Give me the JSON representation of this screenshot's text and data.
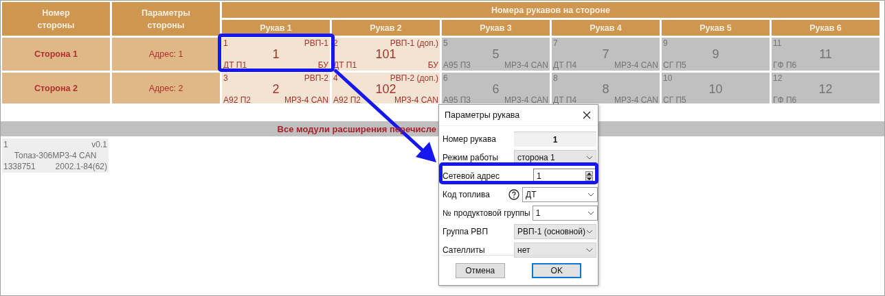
{
  "table": {
    "columns": [
      {
        "label": "Номер стороны"
      },
      {
        "label": "Параметры стороны"
      }
    ],
    "group_header": "Номера рукавов на стороне",
    "hose_columns": [
      "Рукав 1",
      "Рукав 2",
      "Рукав 3",
      "Рукав 4",
      "Рукав 5",
      "Рукав 6"
    ],
    "sides": [
      {
        "name": "Сторона 1",
        "params": "Адрес: 1",
        "hoses": [
          {
            "index": "1",
            "group": "РВП-1",
            "number": "1",
            "fuel": "ДТ П1",
            "module": "БУ",
            "enabled": true
          },
          {
            "index": "2",
            "group": "РВП-1 (доп.)",
            "number": "101",
            "fuel": "ДТ П1",
            "module": "БУ",
            "enabled": true
          },
          {
            "index": "5",
            "number": "5",
            "fuel": "А95 П3",
            "module": "МР3-4 CAN",
            "enabled": false
          },
          {
            "index": "7",
            "number": "7",
            "fuel": "ДТ П4",
            "module": "МР3-4 CAN",
            "enabled": false
          },
          {
            "index": "9",
            "number": "9",
            "fuel": "СГ П5",
            "enabled": false
          },
          {
            "index": "11",
            "number": "11",
            "fuel": "ГФ П6",
            "enabled": false
          }
        ]
      },
      {
        "name": "Сторона 2",
        "params": "Адрес: 2",
        "hoses": [
          {
            "index": "3",
            "group": "РВП-2",
            "number": "2",
            "fuel": "А92 П2",
            "module": "МР3-4 CAN",
            "enabled": true
          },
          {
            "index": "4",
            "group": "РВП-2 (доп.)",
            "number": "102",
            "fuel": "А92 П2",
            "module": "МР3-4 CAN",
            "enabled": true
          },
          {
            "index": "6",
            "number": "6",
            "fuel": "А95 П3",
            "module": "МР3-4 CAN",
            "enabled": false
          },
          {
            "index": "8",
            "number": "8",
            "fuel": "ДТ П4",
            "module": "МР3-4 CAN",
            "enabled": false
          },
          {
            "index": "10",
            "number": "10",
            "fuel": "СГ П5",
            "enabled": false
          },
          {
            "index": "12",
            "number": "12",
            "fuel": "ГФ П6",
            "enabled": false
          }
        ]
      }
    ]
  },
  "modules_bar": "Все модули расширения перечисле",
  "modules": [
    {
      "index": "1",
      "version": "v0.1",
      "name": "Топаз-306МР3-4 CAN",
      "serial": "1338751",
      "firmware": "2002.1-84(62)"
    }
  ],
  "dialog": {
    "title": "Параметры рукава",
    "fields": [
      {
        "label": "Номер рукава",
        "kind": "readonly",
        "value": "1"
      },
      {
        "label": "Режим работы",
        "kind": "list",
        "value": "сторона 1"
      },
      {
        "label": "Сетевой адрес",
        "kind": "spin",
        "value": "1"
      },
      {
        "label": "Код топлива",
        "kind": "combo",
        "value": "ДТ",
        "help": true
      },
      {
        "label": "№ продуктовой группы",
        "kind": "combo",
        "value": "1"
      },
      {
        "label": "Группа РВП",
        "kind": "list",
        "value": "РВП-1 (основной)"
      },
      {
        "label": "Сателлиты",
        "kind": "list",
        "value": "нет"
      }
    ],
    "buttons": [
      {
        "label": "Отмена",
        "default": false
      },
      {
        "label": "OK",
        "default": true
      }
    ]
  }
}
